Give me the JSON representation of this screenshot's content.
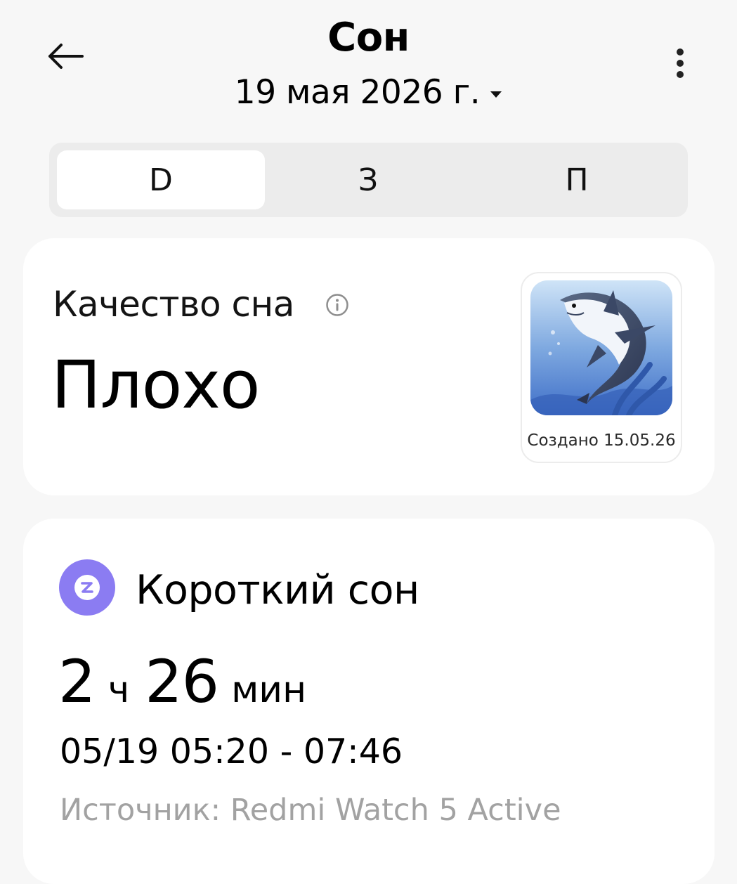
{
  "header": {
    "title": "Сон",
    "date": "19 мая 2026 г."
  },
  "tabs": [
    {
      "label": "D",
      "active": true
    },
    {
      "label": "З",
      "active": false
    },
    {
      "label": "П",
      "active": false
    }
  ],
  "quality": {
    "label": "Качество сна",
    "value": "Плохо",
    "badge_caption": "Создано 15.05.26"
  },
  "nap": {
    "title": "Короткий сон",
    "hours": "2",
    "hours_unit": "ч",
    "minutes": "26",
    "minutes_unit": "мин",
    "time_range": "05/19 05:20 - 07:46",
    "source": "Источник: Redmi Watch 5 Active"
  },
  "colors": {
    "background": "#f7f7f7",
    "card": "#ffffff",
    "segment_bg": "#ececec",
    "nap_icon": "#8b7cf2",
    "muted_text": "#a2a2a2"
  },
  "icons": {
    "back": "arrow-left-icon",
    "date_dropdown": "caret-down-icon",
    "menu": "more-vertical-icon",
    "info": "info-icon",
    "badge": "shark-illustration",
    "nap": "sleep-z-icon"
  }
}
